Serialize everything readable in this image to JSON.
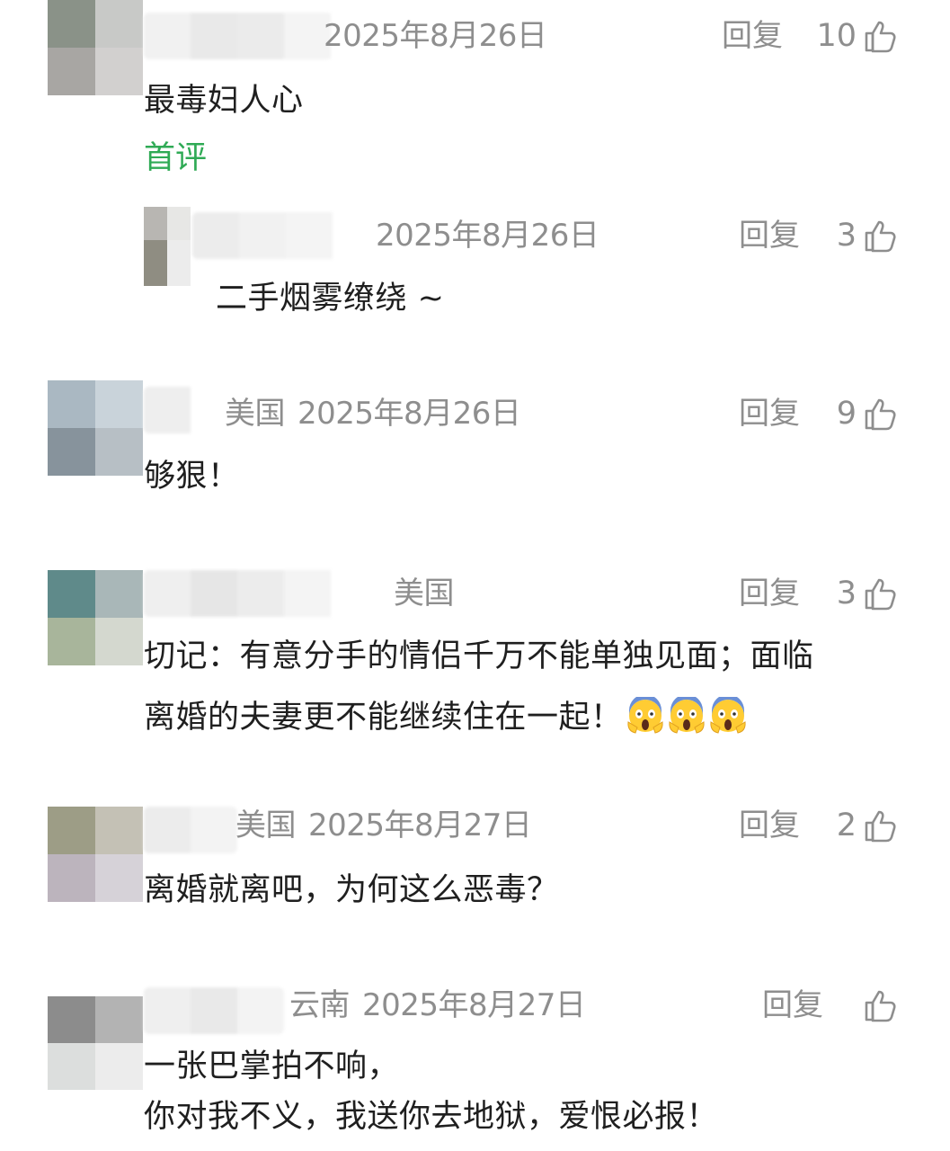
{
  "comments": [
    {
      "location": "",
      "date": "2025年8月26日",
      "reply_label": "回复",
      "likes": "10",
      "text": "最毒妇人心",
      "tag": "首评",
      "replies": [
        {
          "location": "",
          "date": "2025年8月26日",
          "reply_label": "回复",
          "likes": "3",
          "text": "二手烟雾缭绕 ~"
        }
      ]
    },
    {
      "location": "美国",
      "date": "2025年8月26日",
      "reply_label": "回复",
      "likes": "9",
      "text": "够狠！"
    },
    {
      "location": "美国",
      "date": "",
      "reply_label": "回复",
      "likes": "3",
      "text_line1": "切记：有意分手的情侣千万不能单独见面；面临",
      "text_line2": "离婚的夫妻更不能继续住在一起！",
      "emoji": "screaming-face-emoji"
    },
    {
      "location": "美国",
      "date": "2025年8月27日",
      "reply_label": "回复",
      "likes": "2",
      "text": "离婚就离吧，为何这么恶毒？"
    },
    {
      "location": "云南",
      "date": "2025年8月27日",
      "reply_label": "回复",
      "likes": "",
      "text_line1": "一张巴掌拍不响，",
      "text_line2": "你对我不义，我送你去地狱，爱恨必报！"
    }
  ],
  "colors": {
    "meta_gray": "#8e8e8e",
    "tag_green": "#2faa55",
    "text": "#1f1f1f"
  },
  "icons": {
    "like": "thumbs-up-icon"
  }
}
